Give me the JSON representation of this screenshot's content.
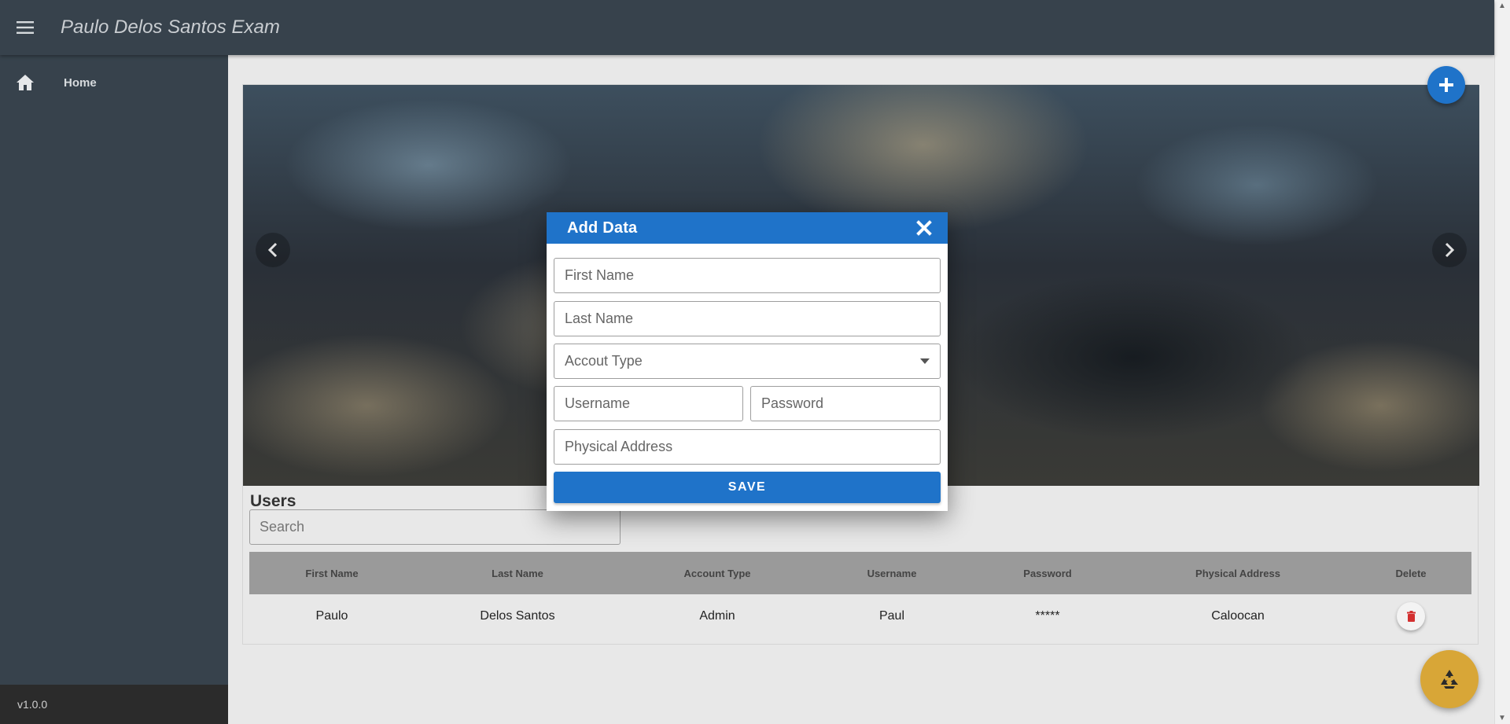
{
  "app": {
    "title": "Paulo Delos Santos Exam",
    "version": "v1.0.0"
  },
  "sidebar": {
    "items": [
      {
        "label": "Home",
        "icon": "home-icon"
      }
    ]
  },
  "users": {
    "title": "Users",
    "search_placeholder": "Search",
    "columns": [
      "First Name",
      "Last Name",
      "Account Type",
      "Username",
      "Password",
      "Physical Address",
      "Delete"
    ],
    "rows": [
      {
        "first_name": "Paulo",
        "last_name": "Delos Santos",
        "account_type": "Admin",
        "username": "Paul",
        "password": "*****",
        "address": "Caloocan"
      }
    ]
  },
  "dialog": {
    "title": "Add Data",
    "first_name_placeholder": "First Name",
    "last_name_placeholder": "Last Name",
    "account_type_placeholder": "Accout Type",
    "username_placeholder": "Username",
    "password_placeholder": "Password",
    "address_placeholder": "Physical Address",
    "save_label": "SAVE"
  },
  "colors": {
    "appbar": "#37424c",
    "primary": "#1f73c9",
    "fab_recycle": "#d8a637",
    "delete_icon": "#d32f2f"
  }
}
